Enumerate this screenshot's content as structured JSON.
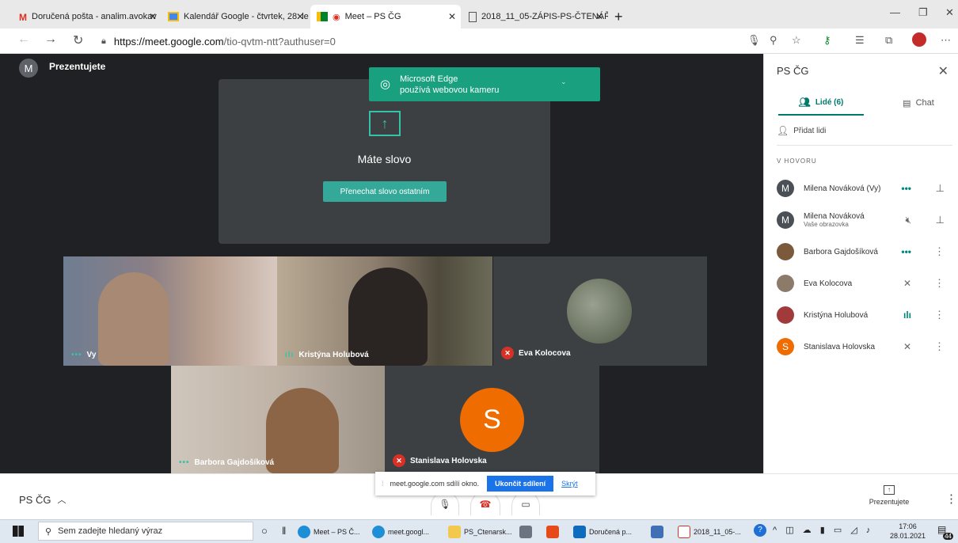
{
  "browser": {
    "tabs": [
      {
        "label": "Doručená pošta - analim.avokav"
      },
      {
        "label": "Kalendář Google - čtvrtek, 28. le"
      },
      {
        "label": "Meet – PS ČG"
      },
      {
        "label": "2018_11_05-ZÁPIS-PS-ČTENÁŘS"
      }
    ],
    "new_tab": "+",
    "url_host": "https://meet.google.com",
    "url_rest": "/tio-qvtm-ntt?authuser=0"
  },
  "meet": {
    "self_avatar": "M",
    "presenting_label": "Prezentujete",
    "presentation_title": "Máte slovo",
    "stop_button": "Přenechat slovo ostatním",
    "camera_notice_title": "Microsoft Edge",
    "camera_notice_sub": "používá webovou kameru",
    "tiles": [
      {
        "name": "Vy"
      },
      {
        "name": "Kristýna Holubová"
      },
      {
        "name": "Eva Kolocova"
      },
      {
        "name": "Barbora Gajdošíková"
      },
      {
        "name": "Stanislava Holovska",
        "initial": "S"
      }
    ]
  },
  "side": {
    "title": "PS ČG",
    "tab_people": "Lidé (6)",
    "tab_chat": "Chat",
    "add_people": "Přidat lidi",
    "section": "V HOVORU",
    "people": [
      {
        "initial": "M",
        "name": "Milena Nováková (Vy)",
        "sub": ""
      },
      {
        "initial": "M",
        "name": "Milena Nováková",
        "sub": "Vaše obrazovka"
      },
      {
        "initial": "",
        "name": "Barbora Gajdošíková",
        "sub": ""
      },
      {
        "initial": "",
        "name": "Eva Kolocova",
        "sub": ""
      },
      {
        "initial": "",
        "name": "Kristýna Holubová",
        "sub": ""
      },
      {
        "initial": "S",
        "name": "Stanislava Holovska",
        "sub": ""
      }
    ]
  },
  "bottom": {
    "meeting_name": "PS ČG",
    "share_text": "meet.google.com sdílí okno.",
    "stop_share": "Ukončit sdílení",
    "hide": "Skrýt",
    "presenting": "Prezentujete"
  },
  "taskbar": {
    "search": "Sem zadejte hledaný výraz",
    "apps": [
      "Meet – PS Č...",
      "meet.googl...",
      "PS_Ctenarsk...",
      "Doručená p...",
      "2018_11_05-..."
    ],
    "time": "17:06",
    "date": "28.01.2021",
    "notif": "44"
  }
}
